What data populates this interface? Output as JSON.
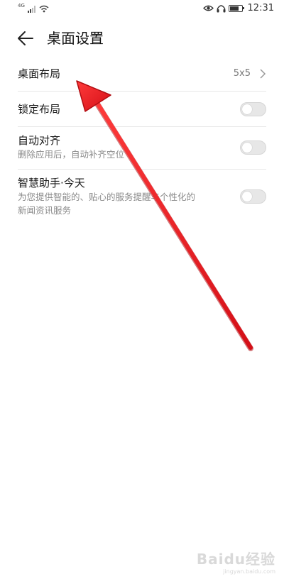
{
  "status_bar": {
    "network": "4G",
    "time": "12:31",
    "battery_level": 0.8,
    "icons": [
      "signal-icon",
      "wifi-icon",
      "eye-icon",
      "headphone-icon",
      "battery-icon"
    ]
  },
  "header": {
    "title": "桌面设置",
    "back_icon": "arrow-left-icon"
  },
  "settings": [
    {
      "label": "桌面布局",
      "value": "5x5",
      "control": "chevron"
    },
    {
      "label": "锁定布局",
      "control": "toggle",
      "on": false
    },
    {
      "label": "自动对齐",
      "description": "删除应用后，自动补齐空位",
      "control": "toggle",
      "on": false
    },
    {
      "label": "智慧助手·今天",
      "description_lines": [
        "为您提供智能的、贴心的服务提醒与个性化的",
        "新闻资讯服务"
      ],
      "control": "toggle",
      "on": false
    }
  ],
  "annotation": {
    "type": "red-arrow",
    "color": "#e0141b"
  },
  "watermark": {
    "text": "Baidu经验",
    "url": "jingyan.baidu.com"
  }
}
